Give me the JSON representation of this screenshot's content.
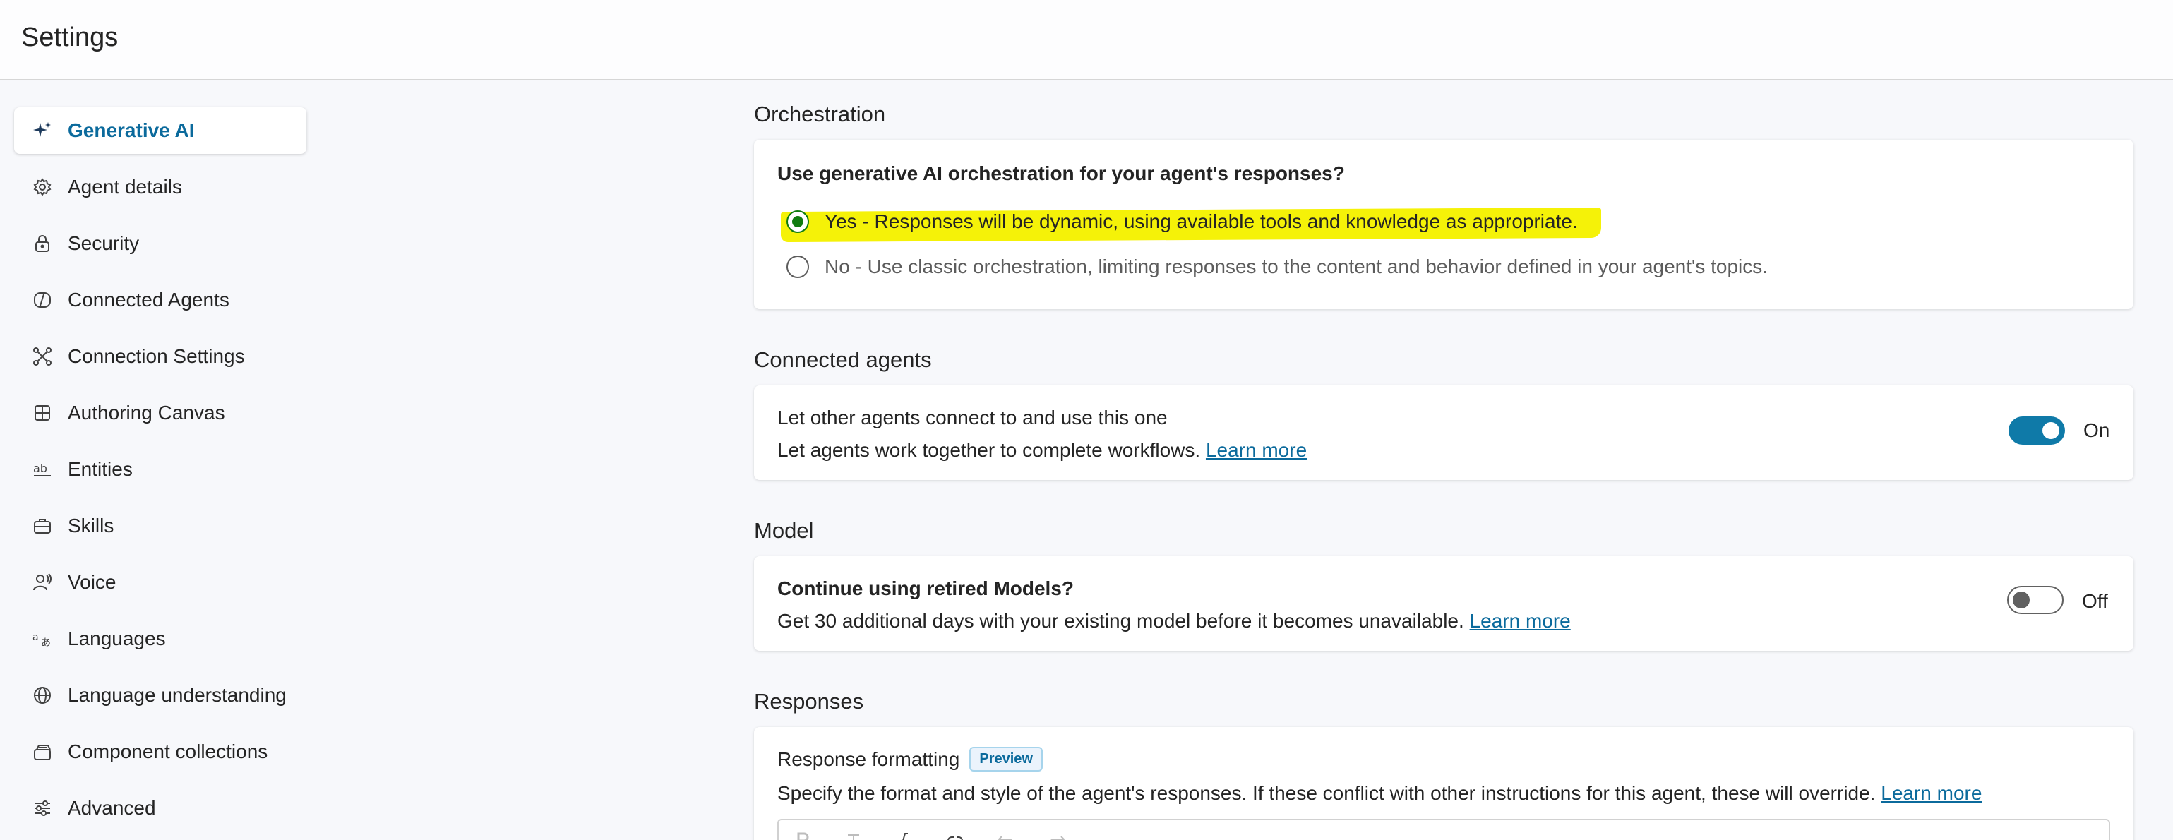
{
  "header": {
    "title": "Settings"
  },
  "sidebar": {
    "items": [
      {
        "label": "Generative AI",
        "icon": "sparkle-icon",
        "active": true
      },
      {
        "label": "Agent details",
        "icon": "gear-icon"
      },
      {
        "label": "Security",
        "icon": "lock-icon"
      },
      {
        "label": "Connected Agents",
        "icon": "connected-agents-icon"
      },
      {
        "label": "Connection Settings",
        "icon": "network-icon"
      },
      {
        "label": "Authoring Canvas",
        "icon": "grid-icon"
      },
      {
        "label": "Entities",
        "icon": "ab-icon"
      },
      {
        "label": "Skills",
        "icon": "briefcase-icon"
      },
      {
        "label": "Voice",
        "icon": "person-voice-icon"
      },
      {
        "label": "Languages",
        "icon": "translate-icon"
      },
      {
        "label": "Language understanding",
        "icon": "globe-icon"
      },
      {
        "label": "Component collections",
        "icon": "collection-icon"
      },
      {
        "label": "Advanced",
        "icon": "sliders-icon"
      }
    ]
  },
  "orchestration": {
    "section_title": "Orchestration",
    "question": "Use generative AI orchestration for your agent's responses?",
    "options": [
      {
        "label": "Yes - Responses will be dynamic, using available tools and knowledge as appropriate.",
        "selected": true
      },
      {
        "label": "No - Use classic orchestration, limiting responses to the content and behavior defined in your agent's topics.",
        "selected": false
      }
    ],
    "highlight_color": "#f5f208"
  },
  "connected_agents": {
    "section_title": "Connected agents",
    "title": "Let other agents connect to and use this one",
    "description": "Let agents work together to complete workflows.",
    "link": "Learn more",
    "toggle_state": "On",
    "toggle_on": true
  },
  "model": {
    "section_title": "Model",
    "title": "Continue using retired Models?",
    "description": "Get 30 additional days with your existing model before it becomes unavailable.",
    "link": "Learn more",
    "toggle_state": "Off",
    "toggle_on": false
  },
  "responses": {
    "section_title": "Responses",
    "title": "Response formatting",
    "badge": "Preview",
    "description": "Specify the format and style of the agent's responses. If these conflict with other instructions for this agent, these will override.",
    "link": "Learn more"
  },
  "colors": {
    "accent": "#0b6a9c",
    "toggle_on": "#0f7aa8",
    "radio_selected": "#107c10"
  }
}
